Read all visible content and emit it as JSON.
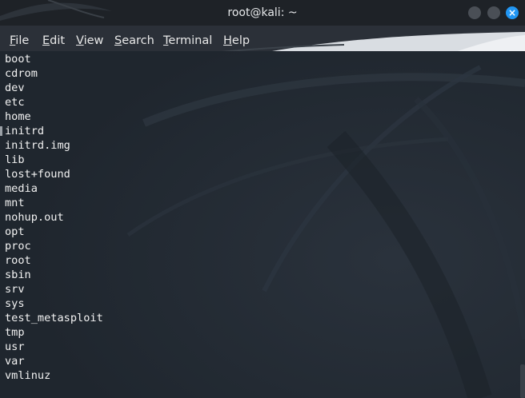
{
  "window": {
    "title": "root@kali: ~"
  },
  "menu": [
    {
      "mnemonic": "F",
      "rest": "ile"
    },
    {
      "mnemonic": "E",
      "rest": "dit"
    },
    {
      "mnemonic": "V",
      "rest": "iew"
    },
    {
      "mnemonic": "S",
      "rest": "earch"
    },
    {
      "mnemonic": "T",
      "rest": "erminal"
    },
    {
      "mnemonic": "H",
      "rest": "elp"
    }
  ],
  "terminal": {
    "lines": [
      "boot",
      "cdrom",
      "dev",
      "etc",
      "home",
      "initrd",
      "initrd.img",
      "lib",
      "lost+found",
      "media",
      "mnt",
      "nohup.out",
      "opt",
      "proc",
      "root",
      "sbin",
      "srv",
      "sys",
      "test_metasploit",
      "tmp",
      "usr",
      "var",
      "vmlinuz"
    ]
  },
  "icons": {
    "minimize": "minimize-icon",
    "maximize": "maximize-icon",
    "close": "close-icon"
  },
  "colors": {
    "accent": "#2196f3",
    "terminal_bg": "#222932",
    "text": "#f2f2f2"
  }
}
